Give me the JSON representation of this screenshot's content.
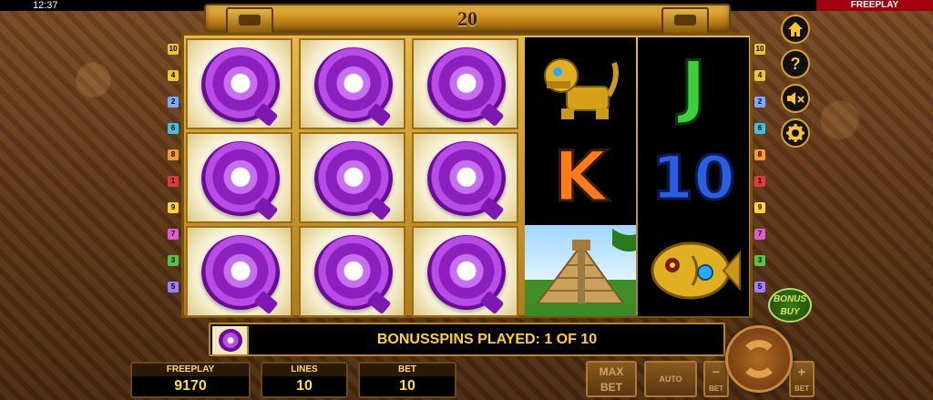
{
  "status": {
    "clock": "12:37",
    "mode_tag": "FREEPLAY"
  },
  "header": {
    "lines_count": "20"
  },
  "lines_left": [
    "10",
    "4",
    "2",
    "6",
    "8",
    "1",
    "9",
    "7",
    "3",
    "5"
  ],
  "lines_right": [
    "10",
    "4",
    "2",
    "6",
    "8",
    "1",
    "9",
    "7",
    "3",
    "5"
  ],
  "lines_colors": [
    "#e8c82a",
    "#e8c82a",
    "#7aa9ff",
    "#3fc1e0",
    "#f29a2e",
    "#e23a3a",
    "#ffd23a",
    "#e05ad0",
    "#56c24a",
    "#a07cff"
  ],
  "reels": {
    "col1": [
      "Q",
      "Q",
      "Q"
    ],
    "col2": [
      "Q",
      "Q",
      "Q"
    ],
    "col3": [
      "Q",
      "Q",
      "Q"
    ],
    "col4": [
      "jaguar",
      "K",
      "pyramid"
    ],
    "col5": [
      "J",
      "10",
      "fish"
    ]
  },
  "symbols": {
    "K_label": "K",
    "J_label": "J",
    "ten_label": "10"
  },
  "side_buttons": [
    "home-icon",
    "help-icon",
    "sound-off-icon",
    "settings-icon"
  ],
  "side_glyphs": {
    "help": "?"
  },
  "bonus_buy": {
    "line1": "BONUS",
    "line2": "BUY"
  },
  "message": "BONUSSPINS PLAYED: 1 OF 10",
  "panels": {
    "freeplay": {
      "label": "FREEPLAY",
      "value": "9170"
    },
    "lines": {
      "label": "LINES",
      "value": "10"
    },
    "bet": {
      "label": "BET",
      "value": "10"
    }
  },
  "controls": {
    "max_bet_line1": "MAX",
    "max_bet_line2": "BET",
    "auto": "AUTO",
    "bet_minus_sign": "−",
    "bet_minus_label": "BET",
    "bet_plus_sign": "+",
    "bet_plus_label": "BET"
  }
}
